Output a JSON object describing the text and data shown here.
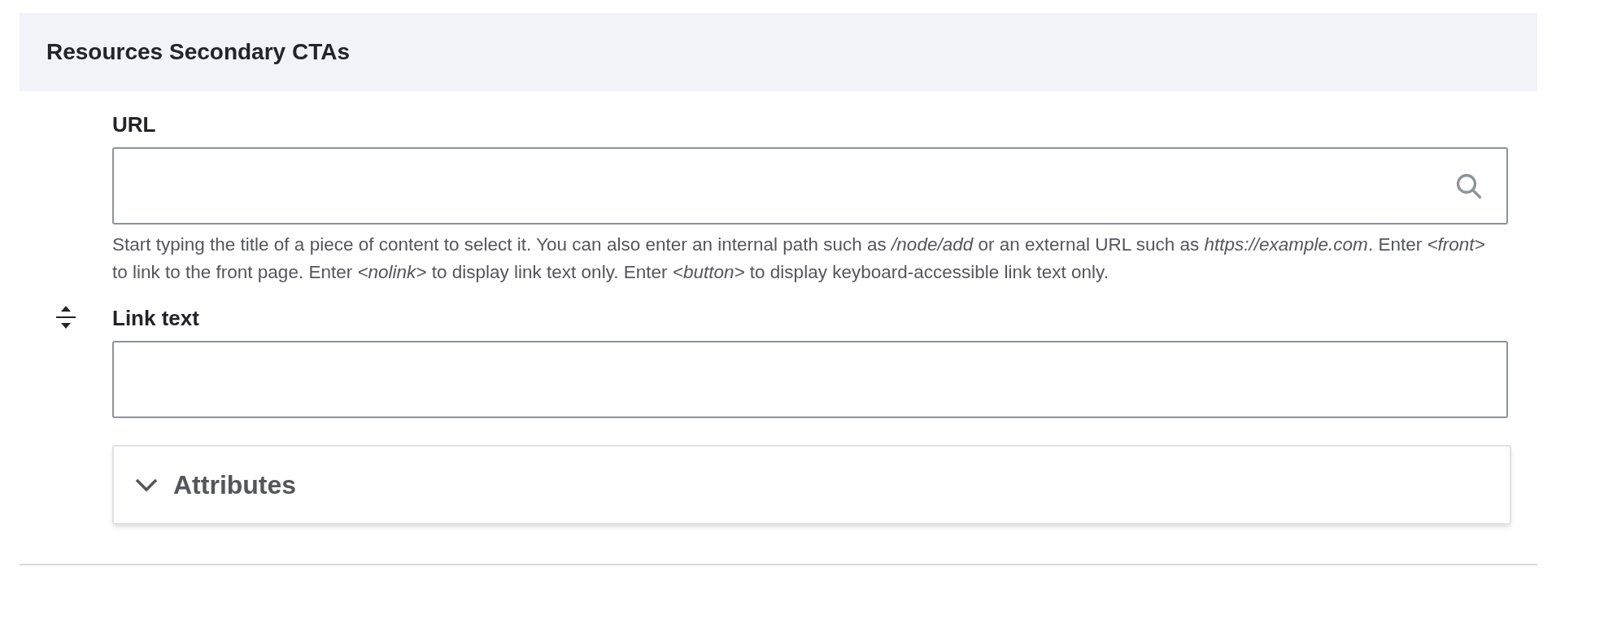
{
  "section": {
    "title": "Resources Secondary CTAs"
  },
  "url_field": {
    "label": "URL",
    "description": "Start typing the title of a piece of content to select it. You can also enter an internal path such as */node/add* or an external URL such as *https://example.com*. Enter *<front>* to link to the front page. Enter *<nolink>* to display link text only. Enter *<button>* to display keyboard-accessible link text only."
  },
  "link_text_field": {
    "label": "Link text"
  },
  "details": {
    "label": "Attributes",
    "expanded": false
  }
}
